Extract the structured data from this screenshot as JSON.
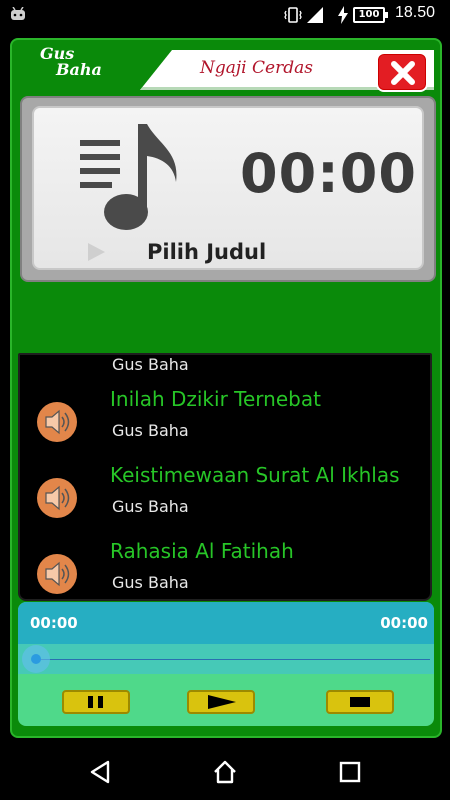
{
  "status_bar": {
    "time": "18.50",
    "battery": "100",
    "icons": [
      "android-icon",
      "vibrate-icon",
      "signal-icon",
      "charging-icon",
      "battery-icon"
    ]
  },
  "header": {
    "logo_line1": "Gus",
    "logo_line2": "Baha",
    "title": "Ngaji Cerdas",
    "close_icon": "close-icon"
  },
  "display": {
    "timer": "00:00",
    "selected_title": "Pilih Judul",
    "music_icon": "music-note-icon"
  },
  "playlist": {
    "partial_artist": "Gus Baha",
    "tracks": [
      {
        "title": "Inilah Dzikir Ternebat",
        "artist": "Gus Baha"
      },
      {
        "title": "Keistimewaan Surat Al Ikhlas",
        "artist": "Gus Baha"
      },
      {
        "title": "Rahasia Al Fatihah",
        "artist": "Gus Baha"
      }
    ]
  },
  "player": {
    "current_time": "00:00",
    "total_time": "00:00",
    "progress": 0,
    "controls": [
      "pause-icon",
      "play-icon",
      "stop-icon"
    ]
  },
  "nav": [
    "back-icon",
    "home-icon",
    "recents-icon"
  ],
  "colors": {
    "frame_green": "#0a8a0a",
    "track_title_green": "#27c527",
    "close_red": "#e31d23",
    "player_teal": "#26aec2",
    "control_yellow": "#d9c30e"
  }
}
